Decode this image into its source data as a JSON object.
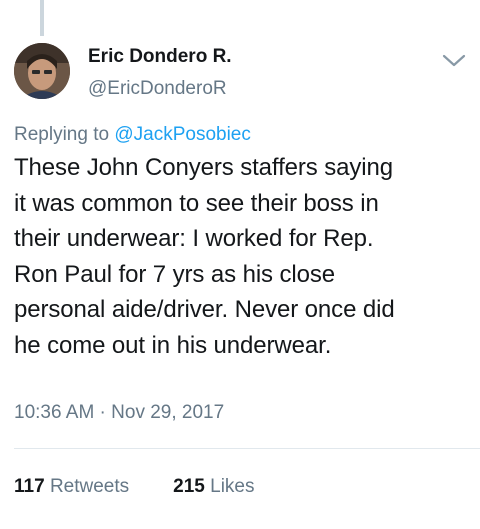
{
  "tweet": {
    "author": {
      "name": "Eric Dondero R.",
      "handle": "@EricDonderoR"
    },
    "reply_prefix": "Replying to ",
    "reply_to": "@JackPosobiec",
    "text": "These John Conyers staffers saying\nit was common to see their boss in\ntheir underwear: I worked for Rep.\nRon Paul for 7 yrs as his close\npersonal aide/driver.  Never once did\nhe come out in his underwear.",
    "timestamp": "10:36 AM · Nov 29, 2017",
    "retweets": {
      "count": "117",
      "label": "Retweets"
    },
    "likes": {
      "count": "215",
      "label": "Likes"
    }
  },
  "icons": {
    "menu": "chevron-down-icon"
  },
  "colors": {
    "text": "#14171a",
    "secondary": "#657786",
    "link": "#1da1f2",
    "divider": "#e1e8ed"
  }
}
